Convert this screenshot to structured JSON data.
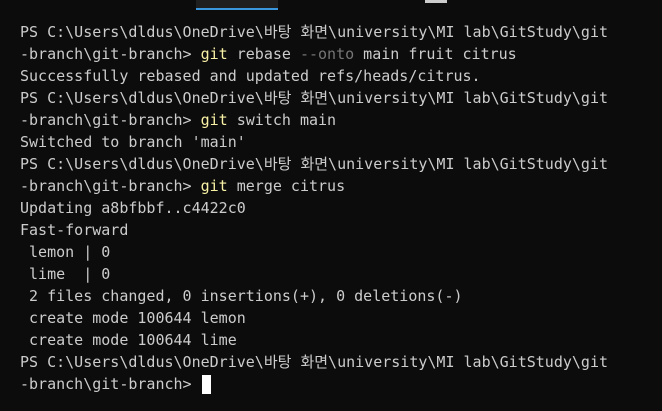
{
  "prompt": {
    "path_part1": "PS C:\\Users\\dldus\\OneDrive\\바탕 화면\\university\\MI lab\\GitStudy\\git",
    "path_part2": "-branch\\git-branch> "
  },
  "commands": [
    {
      "cmd": "git",
      "args_before_flag": " rebase ",
      "flag": "--onto",
      "args_after_flag": " main fruit citrus"
    },
    {
      "cmd": "git",
      "args": " switch main"
    },
    {
      "cmd": "git",
      "args": " merge citrus"
    }
  ],
  "outputs": {
    "rebase_result": "Successfully rebased and updated refs/heads/citrus.",
    "switch_result": "Switched to branch 'main'",
    "merge_lines": [
      "Updating a8bfbbf..c4422c0",
      "Fast-forward",
      " lemon | 0",
      " lime  | 0",
      " 2 files changed, 0 insertions(+), 0 deletions(-)",
      " create mode 100644 lemon",
      " create mode 100644 lime"
    ]
  },
  "colors": {
    "background": "#0c0c0c",
    "foreground": "#cccccc",
    "command": "#f9f1a5",
    "flag": "#767676",
    "cursor": "#ffffff"
  }
}
